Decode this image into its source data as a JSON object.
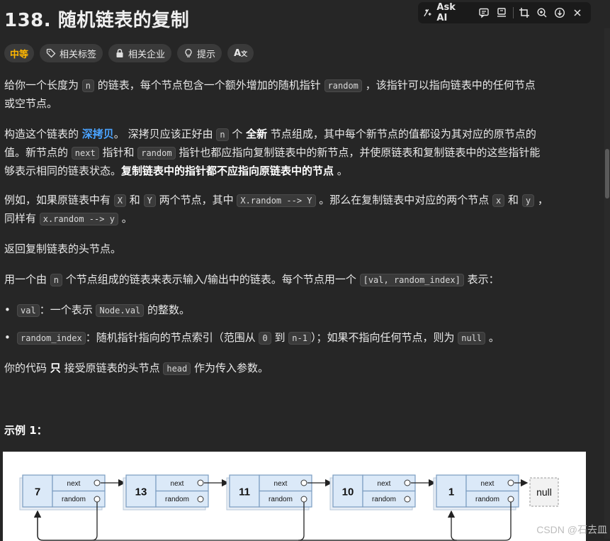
{
  "problem": {
    "title": "138. 随机链表的复制",
    "difficulty": "中等",
    "tags": [
      "相关标签",
      "相关企业",
      "提示"
    ]
  },
  "toolbar": {
    "ask_ai": "Ask AI"
  },
  "paragraphs": {
    "p1": [
      "给你一个长度为 ",
      "n",
      " 的链表，每个节点包含一个额外增加的随机指针 ",
      "random",
      " ，该指针可以指向链表中的任何节点",
      "或空节点。"
    ],
    "p2": [
      "构造这个链表的 ",
      "深拷贝",
      "。 深拷贝应该正好由 ",
      "n",
      " 个 ",
      "全新",
      " 节点组成，其中每个新节点的值都设为其对应的原节点的",
      "值。新节点的 ",
      "next",
      " 指针和 ",
      "random",
      " 指针也都应指向复制链表中的新节点，并使原链表和复制链表中的这些指针能",
      "够表示相同的链表状态。",
      "复制链表中的指针都不应指向原链表中的节点",
      " 。"
    ],
    "p3": [
      "例如，如果原链表中有 ",
      "X",
      " 和 ",
      "Y",
      " 两个节点，其中 ",
      "X.random --> Y",
      " 。那么在复制链表中对应的两个节点 ",
      "x",
      " 和 ",
      "y",
      " ，",
      "同样有 ",
      "x.random --> y",
      " 。"
    ],
    "p4": "返回复制链表的头节点。",
    "p5": [
      "用一个由 ",
      "n",
      " 个节点组成的链表来表示输入/输出中的链表。每个节点用一个 ",
      "[val, random_index]",
      " 表示："
    ],
    "b1": [
      "val",
      "：一个表示 ",
      "Node.val",
      " 的整数。"
    ],
    "b2": [
      "random_index",
      "：随机指针指向的节点索引（范围从 ",
      "0",
      " 到 ",
      "n-1",
      "）；如果不指向任何节点，则为 ",
      "null",
      " 。"
    ],
    "p6": [
      "你的代码 ",
      "只",
      " 接受原链表的头节点 ",
      "head",
      " 作为传入参数。"
    ]
  },
  "example": {
    "title": "示例 1：",
    "nodes": [
      "7",
      "13",
      "11",
      "10",
      "1"
    ],
    "next_label": "next",
    "random_label": "random",
    "null_label": "null"
  },
  "watermark": "CSDN @石去皿",
  "colors": {
    "accent_difficulty": "#ffb700",
    "link": "#4aa3ff",
    "node_fill": "#dbe9f8",
    "node_stroke": "#7a9cc0"
  }
}
